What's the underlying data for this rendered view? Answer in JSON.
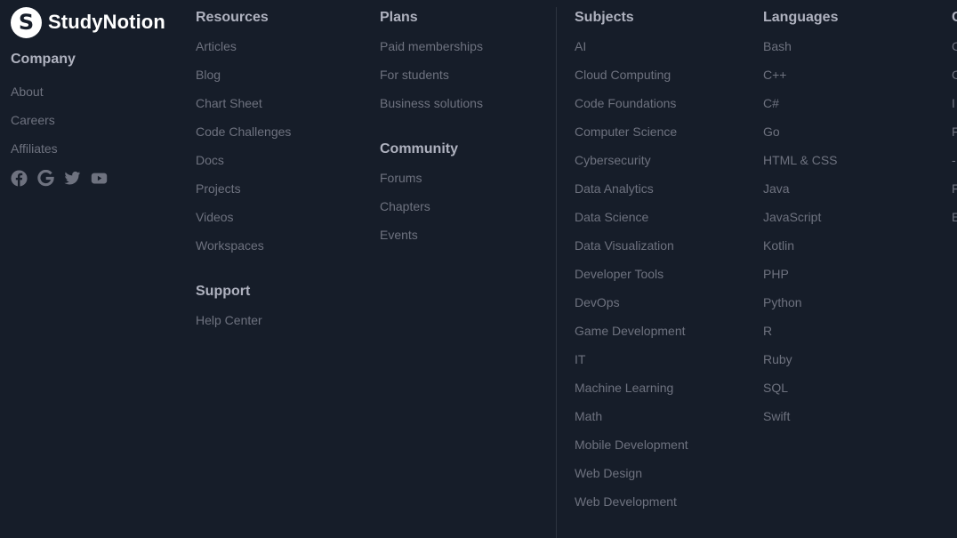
{
  "brand": {
    "logo_letter": "S",
    "name": "StudyNotion"
  },
  "company": {
    "heading": "Company",
    "links": [
      "About",
      "Careers",
      "Affiliates"
    ],
    "socials": [
      "facebook-icon",
      "google-icon",
      "twitter-icon",
      "youtube-icon"
    ]
  },
  "resources": {
    "heading": "Resources",
    "links": [
      "Articles",
      "Blog",
      "Chart Sheet",
      "Code Challenges",
      "Docs",
      "Projects",
      "Videos",
      "Workspaces"
    ]
  },
  "support": {
    "heading": "Support",
    "links": [
      "Help Center"
    ]
  },
  "plans": {
    "heading": "Plans",
    "links": [
      "Paid memberships",
      "For students",
      "Business solutions"
    ]
  },
  "community": {
    "heading": "Community",
    "links": [
      "Forums",
      "Chapters",
      "Events"
    ]
  },
  "subjects": {
    "heading": "Subjects",
    "links": [
      "AI",
      "Cloud Computing",
      "Code Foundations",
      "Computer Science",
      "Cybersecurity",
      "Data Analytics",
      "Data Science",
      "Data Visualization",
      "Developer Tools",
      "DevOps",
      "Game Development",
      "IT",
      "Machine Learning",
      "Math",
      "Mobile Development",
      "Web Design",
      "Web Development"
    ]
  },
  "languages": {
    "heading": "Languages",
    "links": [
      "Bash",
      "C++",
      "C#",
      "Go",
      "HTML & CSS",
      "Java",
      "JavaScript",
      "Kotlin",
      "PHP",
      "Python",
      "R",
      "Ruby",
      "SQL",
      "Swift"
    ]
  },
  "career": {
    "heading": "C",
    "links": [
      "C",
      "C",
      "I",
      "F",
      "-",
      "F",
      "E"
    ]
  },
  "colors": {
    "background": "#161d29",
    "heading": "#afb2bf",
    "link": "#6e727f",
    "divider": "#2c333f",
    "logo": "#ffffff"
  }
}
